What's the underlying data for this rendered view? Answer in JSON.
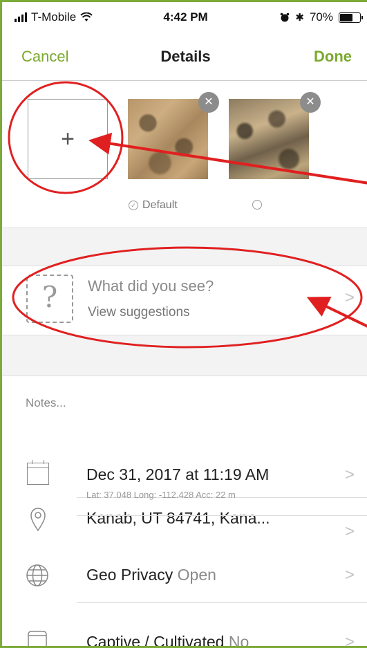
{
  "status_bar": {
    "carrier": "T-Mobile",
    "time": "4:42 PM",
    "battery_percent": "70%",
    "battery_level": 0.7
  },
  "navbar": {
    "cancel": "Cancel",
    "title": "Details",
    "done": "Done"
  },
  "photos": {
    "add_label": "+",
    "remove_label": "✕",
    "default_label": "Default"
  },
  "species": {
    "icon_glyph": "?",
    "title": "What did you see?",
    "subtitle": "View suggestions"
  },
  "notes": {
    "placeholder": "Notes..."
  },
  "rows": {
    "date": "Dec 31, 2017 at 11:19 AM",
    "location": "Kanab, UT  84741, Kana...",
    "location_meta": "Lat: 37.048  Long: -112.428  Acc: 22 m",
    "geo_privacy_label": "Geo Privacy",
    "geo_privacy_value": "Open",
    "captive_label": "Captive / Cultivated",
    "captive_value": "No"
  },
  "chevron": ">",
  "colors": {
    "accent_green": "#7aa92d",
    "annotation_red": "#e02020"
  }
}
